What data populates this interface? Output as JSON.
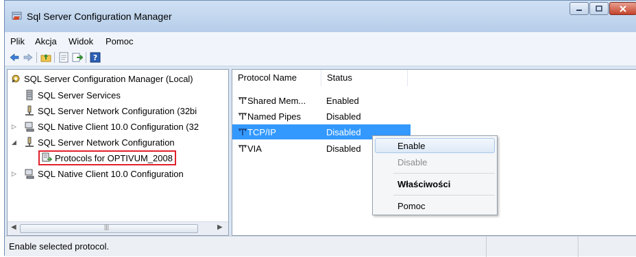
{
  "window": {
    "title": "Sql Server Configuration Manager"
  },
  "menu": [
    "Plik",
    "Akcja",
    "Widok",
    "Pomoc"
  ],
  "tree": {
    "root": "SQL Server Configuration Manager (Local)",
    "items": [
      "SQL Server Services",
      "SQL Server Network Configuration (32bi",
      "SQL Native Client 10.0 Configuration (32",
      "SQL Server Network Configuration",
      "Protocols for OPTIVUM_2008",
      "SQL Native Client 10.0 Configuration"
    ]
  },
  "list": {
    "columns": [
      "Protocol Name",
      "Status"
    ],
    "rows": [
      {
        "name": "Shared Mem...",
        "status": "Enabled"
      },
      {
        "name": "Named Pipes",
        "status": "Disabled"
      },
      {
        "name": "TCP/IP",
        "status": "Disabled"
      },
      {
        "name": "VIA",
        "status": "Disabled"
      }
    ]
  },
  "context_menu": [
    "Enable",
    "Disable",
    "Właściwości",
    "Pomoc"
  ],
  "status": {
    "text": "Enable selected protocol."
  },
  "colors": {
    "selection": "#3399ff",
    "highlight_border": "#e0202a"
  }
}
